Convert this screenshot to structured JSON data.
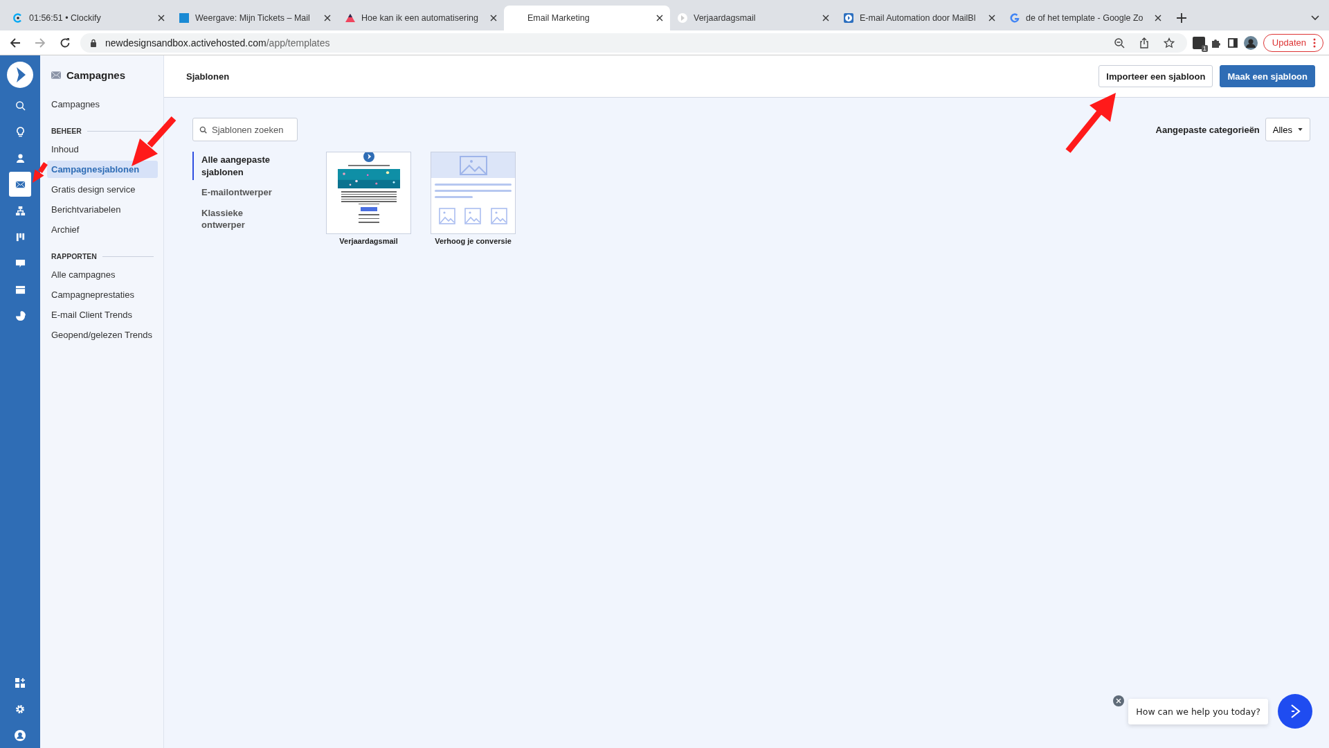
{
  "browser": {
    "tabs": [
      {
        "title": "01:56:51 • Clockify",
        "selected": false
      },
      {
        "title": "Weergave: Mijn Tickets – Mail",
        "selected": false
      },
      {
        "title": "Hoe kan ik een automatisering",
        "selected": false
      },
      {
        "title": "Email Marketing",
        "selected": true
      },
      {
        "title": "Verjaardagsmail",
        "selected": false
      },
      {
        "title": "E-mail Automation door MailBl",
        "selected": false
      },
      {
        "title": "de of het template - Google Zo",
        "selected": false
      }
    ],
    "url_host": "newdesignsandbox.activehosted.com",
    "url_path": "/app/templates",
    "extension_badge": "1",
    "update_button": "Updaten"
  },
  "rail": {
    "items": [
      {
        "selected": false
      },
      {
        "selected": false
      },
      {
        "selected": false
      },
      {
        "selected": true
      },
      {
        "selected": false
      },
      {
        "selected": false
      },
      {
        "selected": false
      },
      {
        "selected": false
      },
      {
        "selected": false
      }
    ]
  },
  "sidebar": {
    "title": "Campagnes",
    "top_link": {
      "label": "Campagnes",
      "selected": false
    },
    "sections": [
      {
        "heading": "BEHEER",
        "items": [
          {
            "label": "Inhoud",
            "selected": false
          },
          {
            "label": "Campagnesjablonen",
            "selected": true
          },
          {
            "label": "Gratis design service",
            "selected": false
          },
          {
            "label": "Berichtvariabelen",
            "selected": false
          },
          {
            "label": "Archief",
            "selected": false
          }
        ]
      },
      {
        "heading": "RAPPORTEN",
        "items": [
          {
            "label": "Alle campagnes",
            "selected": false
          },
          {
            "label": "Campagneprestaties",
            "selected": false
          },
          {
            "label": "E-mail Client Trends",
            "selected": false
          },
          {
            "label": "Geopend/gelezen Trends",
            "selected": false
          }
        ]
      }
    ]
  },
  "header": {
    "title": "Sjablonen",
    "buttons": [
      {
        "label": "Importeer een sjabloon",
        "kind": "secondary"
      },
      {
        "label": "Maak een sjabloon",
        "kind": "primary"
      }
    ]
  },
  "search": {
    "placeholder": "Sjablonen zoeken"
  },
  "filters": [
    {
      "label": "Alle aangepaste sjablonen",
      "selected": true
    },
    {
      "label": "E-mailontwerper",
      "selected": false
    },
    {
      "label": "Klassieke ontwerper",
      "selected": false
    }
  ],
  "categories": {
    "label": "Aangepaste categorieën",
    "value": "Alles"
  },
  "templates": [
    {
      "name": "Verjaardagsmail",
      "kind": "email"
    },
    {
      "name": "Verhoog je conversie",
      "kind": "placeholder"
    }
  ],
  "chat": {
    "message": "How can we help you today?"
  }
}
